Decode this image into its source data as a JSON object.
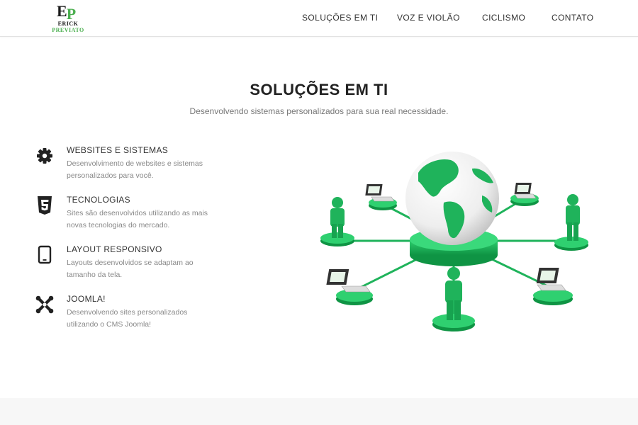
{
  "logo": {
    "mark_e": "E",
    "mark_p": "P",
    "line1": "ERICK",
    "line2": "PREVIATO"
  },
  "nav": [
    {
      "label": "SOLUÇÕES EM TI"
    },
    {
      "label": "VOZ E VIOLÃO"
    },
    {
      "label": "CICLISMO"
    },
    {
      "label": "CONTATO"
    }
  ],
  "section": {
    "title": "SOLUÇÕES EM TI",
    "subtitle": "Desenvolvendo sistemas personalizados para sua real necessidade."
  },
  "features": [
    {
      "icon": "gear-icon",
      "title": "WEBSITES E SISTEMAS",
      "description": "Desenvolvimento de websites e sistemas personalizados para você."
    },
    {
      "icon": "html5-icon",
      "title": "TECNOLOGIAS",
      "description": "Sites são desenvolvidos utilizando as mais novas tecnologias do mercado."
    },
    {
      "icon": "tablet-icon",
      "title": "LAYOUT RESPONSIVO",
      "description": "Layouts desenvolvidos se adaptam ao tamanho da tela."
    },
    {
      "icon": "joomla-icon",
      "title": "JOOMLA!",
      "description": "Desenvolvendo sites personalizados utilizando o CMS Joomla!"
    }
  ],
  "colors": {
    "accent": "#1fb35b",
    "text": "#222222",
    "muted": "#888888"
  },
  "illustration": {
    "icon": "network-globe-illustration"
  }
}
